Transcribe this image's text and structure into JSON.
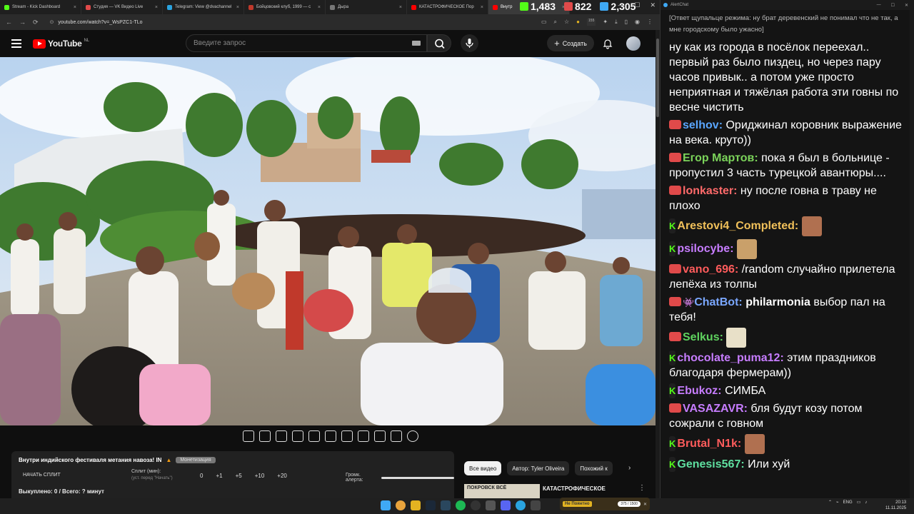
{
  "browser": {
    "tabs": [
      {
        "label": "Stream - Kick Dashboard",
        "color": "#53fc18"
      },
      {
        "label": "Студия — VK Видео Live",
        "color": "#e04a4a"
      },
      {
        "label": "Telegram: View @dvachannel",
        "color": "#2aa3df"
      },
      {
        "label": "Бойцовский клуб, 1999 — с",
        "color": "#c0392b"
      },
      {
        "label": "Дыра",
        "color": "#777777"
      },
      {
        "label": "КАТАСТРОФИЧЕСКОЕ Пор",
        "color": "#ff0000"
      },
      {
        "label": "Внутр",
        "color": "#ff0000",
        "active": true
      }
    ],
    "url": "youtube.com/watch?v=_WsPZC1-TLo",
    "ext_badge": "155"
  },
  "stream_counters": [
    {
      "value": "1,483",
      "icon": "kick-icon",
      "color": "#53fc18"
    },
    {
      "value": "822",
      "icon": "vk-live-icon",
      "color": "#e04a4a"
    },
    {
      "value": "2,305",
      "icon": "viewers-icon",
      "color": "#3fa9f5"
    }
  ],
  "youtube": {
    "logo": "YouTube",
    "region": "NL",
    "search_placeholder": "Введите запрос",
    "create_label": "Создать"
  },
  "widget": {
    "title": "Внутри индийского фестиваля метания навоза! IN",
    "tag": "Монетизация",
    "split_button": "НАЧАТЬ СПЛИТ",
    "split_label": "Сплит (мин):",
    "split_hint": "(уст. перед \"Начать\")",
    "split_values": [
      "0",
      "+1",
      "+5",
      "+10",
      "+20"
    ],
    "alert_label": "Громк. алерта:",
    "sold": "Выкуплено: 0 / Всего: ? минут"
  },
  "chips": [
    "Все видео",
    "Автор: Tyler Oliveira",
    "Похожий к"
  ],
  "recommendation": {
    "thumb_text": "ПОКРОВСК ВСЁ",
    "title": "КАТАСТРОФИЧЕСКОЕ"
  },
  "chat": {
    "app_title": "AlertChat",
    "system_message": "[Ответ щупальце режима: ну брат деревенский не понимал что не так, а мне городскому было ужасно]",
    "lead_text": "ну как из города в посёлок переехал.. первый раз было пиздец, но через пару часов привык.. а потом уже просто неприятная и тяжёлая работа эти говны по весне чистить",
    "messages": [
      {
        "platform": "vk",
        "nick": "selhov",
        "nick_color": "#5aa6ff",
        "text": "Ориджинал коровник выражение на века. круто))"
      },
      {
        "platform": "vk",
        "nick": "Егор Мартов",
        "nick_color": "#7bd35a",
        "text": "пока я был в больнице - пропустил 3 часть турецкой авантюры...."
      },
      {
        "platform": "vk",
        "nick": "lonkaster",
        "nick_color": "#ff6a6a",
        "text": "ну после говна в траву не плохо"
      },
      {
        "platform": "kick",
        "nick": "Arestovi4_Completed",
        "nick_color": "#f0c05a",
        "text": "",
        "emote": "#b07050"
      },
      {
        "platform": "kick",
        "nick": "psilocybe",
        "nick_color": "#c77dff",
        "text": "",
        "emote": "#c9a06a"
      },
      {
        "platform": "vk",
        "nick": "vano_696",
        "nick_color": "#ff5c5c",
        "text": "/random случайно прилетела лепёха из толпы"
      },
      {
        "platform": "vk",
        "nick": "ChatBot",
        "nick_color": "#7aa7ff",
        "bot": true,
        "text_bold": "philarmonia",
        "text": " выбор пал на тебя!"
      },
      {
        "platform": "vk",
        "nick": "Selkus",
        "nick_color": "#5fd35f",
        "text": "",
        "emote": "#e8e0c8"
      },
      {
        "platform": "kick",
        "nick": "chocolate_puma12",
        "nick_color": "#c77dff",
        "text": "этим праздников благодаря фермерам))"
      },
      {
        "platform": "kick",
        "nick": "Ebukoz",
        "nick_color": "#c77dff",
        "text": "СИМБА"
      },
      {
        "platform": "vk",
        "nick": "VASAZAVR",
        "nick_color": "#c77dff",
        "text": "бля будут козу потом сожрали с говном"
      },
      {
        "platform": "kick",
        "nick": "Brutal_N1k",
        "nick_color": "#ff5c5c",
        "text": "",
        "emote": "#b07050"
      },
      {
        "platform": "kick",
        "nick": "Genesis567",
        "nick_color": "#5fe0a0",
        "text": "Или хуй"
      }
    ]
  },
  "taskbar": {
    "app_label": "Не Поянтно",
    "counter": "375 / 1500",
    "lang": "ENG",
    "time": "20:13",
    "date": "11.11.2025"
  }
}
